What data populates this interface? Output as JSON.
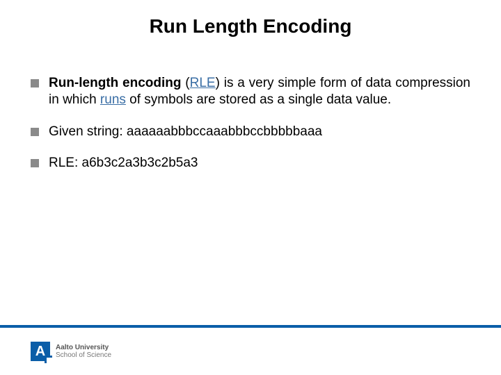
{
  "title": "Run Length Encoding",
  "bullets": [
    {
      "runs": [
        {
          "text": "Run-length encoding",
          "bold": true,
          "link": false
        },
        {
          "text": " (",
          "bold": false,
          "link": false
        },
        {
          "text": "RLE",
          "bold": false,
          "link": true
        },
        {
          "text": ") is a very simple form of data compression in which ",
          "bold": false,
          "link": false
        },
        {
          "text": "runs",
          "bold": false,
          "link": true
        },
        {
          "text": " of symbols are stored as a single data value.",
          "bold": false,
          "link": false
        }
      ]
    },
    {
      "runs": [
        {
          "text": "Given string: aaaaaabbbccaaabbbccbbbbbaaa",
          "bold": false,
          "link": false
        }
      ]
    },
    {
      "runs": [
        {
          "text": "RLE: a6b3c2a3b3c2b5a3",
          "bold": false,
          "link": false
        }
      ]
    }
  ],
  "footer": {
    "logo_letter": "A",
    "university": "Aalto University",
    "school": "School of Science"
  },
  "colors": {
    "accent": "#0b5ea8",
    "bullet_marker": "#8a8a8a",
    "link": "#3a6ea5"
  }
}
